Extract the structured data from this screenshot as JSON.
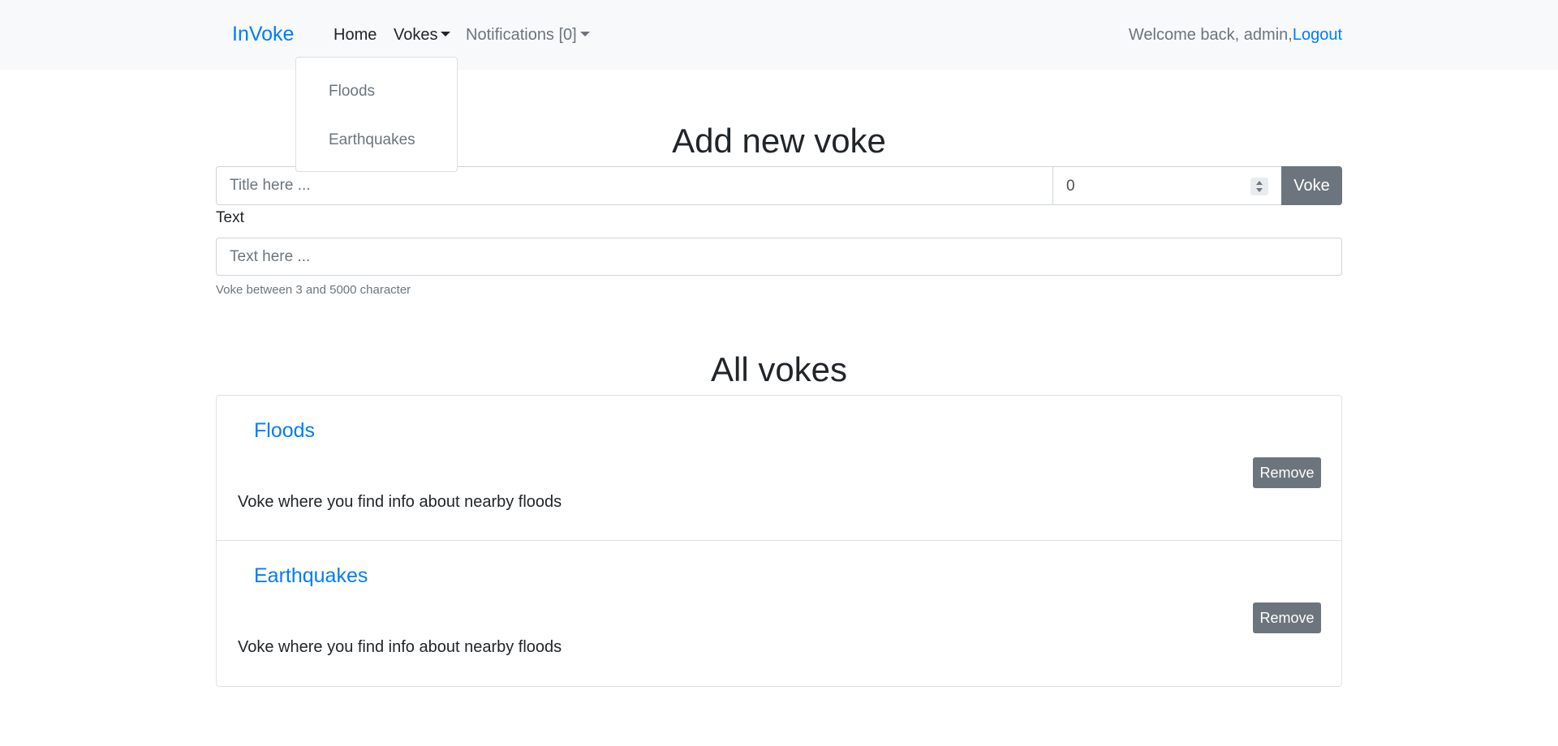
{
  "navbar": {
    "brand": "InVoke",
    "home": "Home",
    "vokes": "Vokes",
    "notifications": "Notifications [0]",
    "welcome": "Welcome back, admin,",
    "logout": "Logout"
  },
  "dropdown": {
    "items": [
      "Floods",
      "Earthquakes"
    ]
  },
  "form": {
    "heading": "Add new voke",
    "title_placeholder": "Title here ...",
    "number_value": "0",
    "submit_label": "Voke",
    "text_label": "Text",
    "text_placeholder": "Text here ...",
    "help": "Voke between 3 and 5000 character"
  },
  "list": {
    "heading": "All vokes",
    "items": [
      {
        "title": "Floods",
        "text": "Voke where you find info about nearby floods",
        "button": "Remove"
      },
      {
        "title": "Earthquakes",
        "text": "Voke where you find info about nearby floods",
        "button": "Remove"
      }
    ]
  },
  "colors": {
    "link": "#007bff",
    "navbar_bg": "#f8f9fa",
    "button_bg": "#6c757d"
  }
}
